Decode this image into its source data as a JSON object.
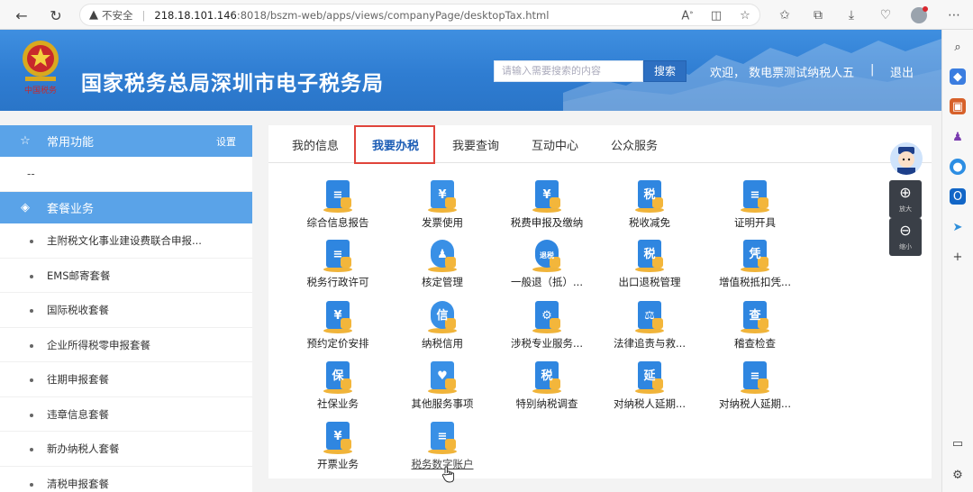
{
  "browser": {
    "security_label": "不安全",
    "url_host": "218.18.101.146",
    "url_path": ":8018/bszm-web/apps/views/companyPage/desktopTax.html"
  },
  "header": {
    "site_title": "国家税务总局深圳市电子税务局",
    "emblem_caption": "中国税务",
    "search_placeholder": "请输入需要搜索的内容",
    "search_button": "搜索",
    "welcome": "欢迎，  数电票测试纳税人五",
    "separator": "|",
    "logout": "退出"
  },
  "sidebar": {
    "common_title": "常用功能",
    "settings": "设置",
    "dash": "--",
    "package_title": "套餐业务",
    "items": [
      "主附税文化事业建设费联合申报...",
      "EMS邮寄套餐",
      "国际税收套餐",
      "企业所得税零申报套餐",
      "往期申报套餐",
      "违章信息套餐",
      "新办纳税人套餐",
      "清税申报套餐"
    ]
  },
  "tabs": [
    "我的信息",
    "我要办税",
    "我要查询",
    "互动中心",
    "公众服务"
  ],
  "tiles": [
    {
      "label": "综合信息报告",
      "glyph": "≡"
    },
    {
      "label": "发票使用",
      "glyph": "¥"
    },
    {
      "label": "税费申报及缴纳",
      "glyph": "¥"
    },
    {
      "label": "税收减免",
      "glyph": "税"
    },
    {
      "label": "证明开具",
      "glyph": "≡"
    },
    {
      "label": "税务行政许可",
      "glyph": "≡"
    },
    {
      "label": "核定管理",
      "glyph": "♟"
    },
    {
      "label": "一般退（抵）...",
      "glyph": "退税"
    },
    {
      "label": "出口退税管理",
      "glyph": "税"
    },
    {
      "label": "增值税抵扣凭...",
      "glyph": "凭"
    },
    {
      "label": "预约定价安排",
      "glyph": "¥"
    },
    {
      "label": "纳税信用",
      "glyph": "信"
    },
    {
      "label": "涉税专业服务...",
      "glyph": "⚙"
    },
    {
      "label": "法律追责与救...",
      "glyph": "⚖"
    },
    {
      "label": "稽查检查",
      "glyph": "查"
    },
    {
      "label": "社保业务",
      "glyph": "保"
    },
    {
      "label": "其他服务事项",
      "glyph": "♥"
    },
    {
      "label": "特别纳税调查",
      "glyph": "税"
    },
    {
      "label": "对纳税人延期...",
      "glyph": "延"
    },
    {
      "label": "对纳税人延期...",
      "glyph": "≡"
    },
    {
      "label": "开票业务",
      "glyph": "¥"
    },
    {
      "label": "税务数字账户",
      "glyph": "≡"
    }
  ],
  "tools": {
    "zoom_in": "放大",
    "zoom_out": "缩小"
  }
}
